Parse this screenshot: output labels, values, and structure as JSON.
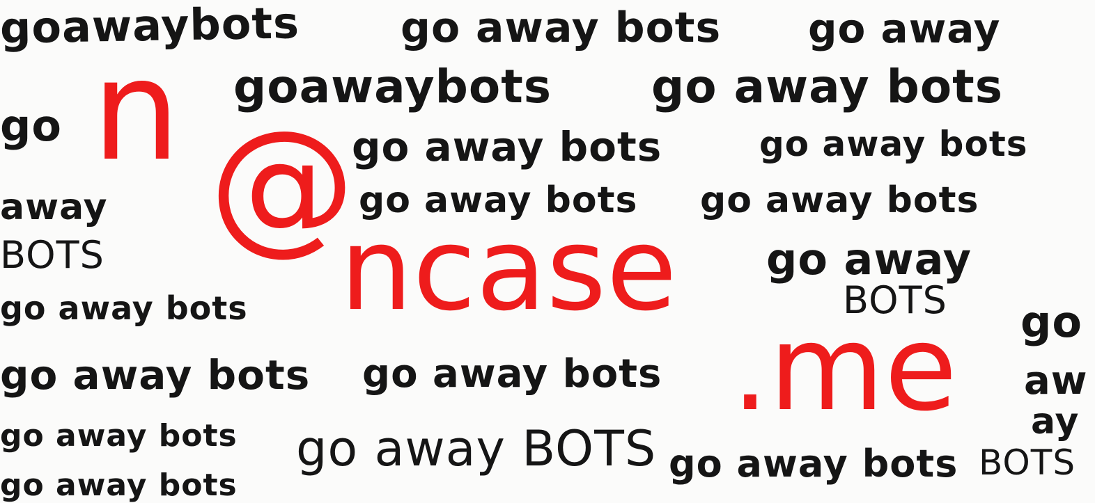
{
  "colors": {
    "ink": "#151515",
    "accent": "#ee1c1c",
    "paper": "#fbfbfa"
  },
  "email": {
    "user": "n",
    "at": "@",
    "domain": "ncase",
    "tld": ".me"
  },
  "scribbles": [
    "goawaybots",
    "go away bots",
    "go away",
    "goawaybots",
    "go away bots",
    "go",
    "go away bots",
    "go away bots",
    "go away bots",
    "go away bots",
    "away",
    "BOTS",
    "go away",
    "BOTS",
    "go away bots",
    "go",
    "go away bots",
    "go away bots",
    "aw",
    "ay",
    "go away bots",
    "go away BOTS",
    "go away bots",
    "BOTS",
    "go away bots"
  ]
}
